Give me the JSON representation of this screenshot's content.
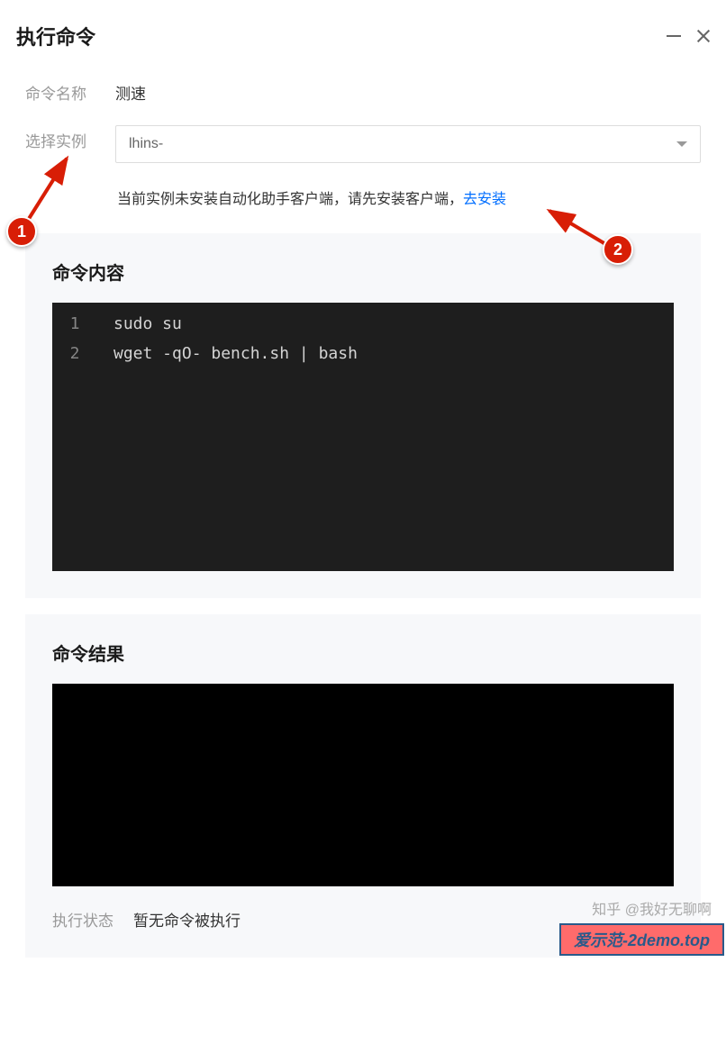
{
  "dialog": {
    "title": "执行命令"
  },
  "form": {
    "name_label": "命令名称",
    "name_value": "测速",
    "instance_label": "选择实例",
    "instance_value": "lhins-"
  },
  "install_tip": {
    "text_prefix": "当前实例未安装自动化助手客户端，请先安装客户端，",
    "link_text": "去安装"
  },
  "content_panel": {
    "title": "命令内容",
    "code": [
      {
        "n": "1",
        "t": "sudo su"
      },
      {
        "n": "2",
        "t": "wget -qO- bench.sh | bash"
      }
    ]
  },
  "result_panel": {
    "title": "命令结果",
    "status_label": "执行状态",
    "status_value": "暂无命令被执行"
  },
  "annotations": {
    "badge1": "1",
    "badge2": "2"
  },
  "watermark": "知乎 @我好无聊啊",
  "footer_tag": "爱示范-2demo.top"
}
